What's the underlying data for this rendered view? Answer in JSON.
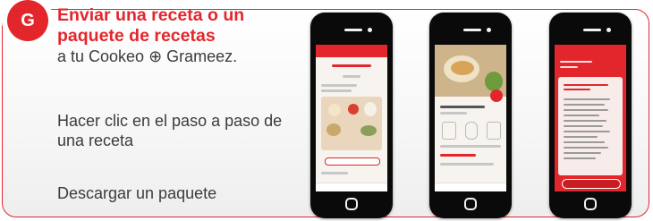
{
  "badge": {
    "letter": "G"
  },
  "heading": {
    "title": "Enviar una receta o un paquete de recetas",
    "subtitle": "a tu Cookeo ⊕ Grameez."
  },
  "steps": [
    {
      "text": "Hacer clic en el paso a paso de una receta"
    },
    {
      "text": "Descargar un paquete"
    }
  ],
  "phones": [
    {
      "screen": "recipe-steps-screen"
    },
    {
      "screen": "recipe-detail-screen"
    },
    {
      "screen": "recipe-pack-screen"
    }
  ],
  "colors": {
    "accent": "#e3262c",
    "text": "#3c3c3c",
    "phone_body": "#0a0a0a"
  }
}
